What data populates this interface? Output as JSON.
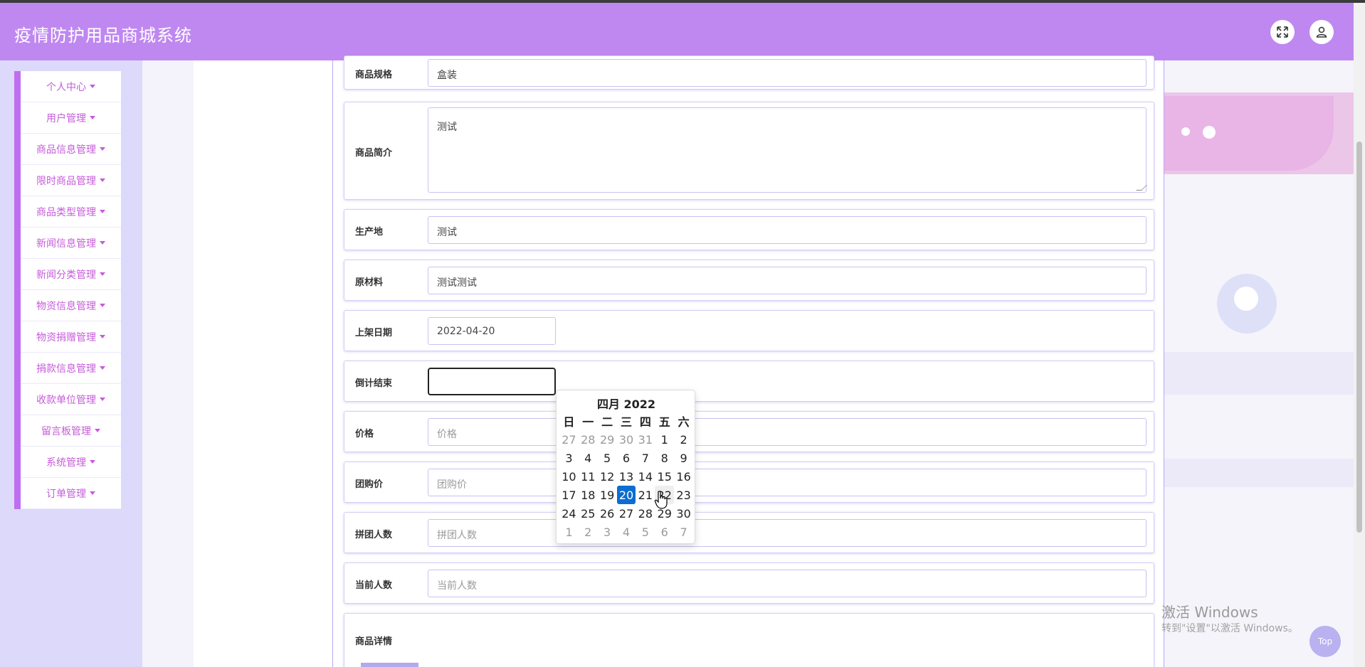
{
  "header": {
    "app_title": "疫情防护用品商城系统",
    "fullscreen_icon": "expand-icon",
    "user_icon": "user-icon"
  },
  "sidebar": {
    "items": [
      {
        "label": "个人中心"
      },
      {
        "label": "用户管理"
      },
      {
        "label": "商品信息管理"
      },
      {
        "label": "限时商品管理"
      },
      {
        "label": "商品类型管理"
      },
      {
        "label": "新闻信息管理"
      },
      {
        "label": "新闻分类管理"
      },
      {
        "label": "物资信息管理"
      },
      {
        "label": "物资捐赠管理"
      },
      {
        "label": "捐款信息管理"
      },
      {
        "label": "收款单位管理"
      },
      {
        "label": "留言板管理"
      },
      {
        "label": "系统管理"
      },
      {
        "label": "订单管理"
      }
    ]
  },
  "form": {
    "spec": {
      "label": "商品规格",
      "value": "盒装"
    },
    "intro": {
      "label": "商品简介",
      "value": "测试"
    },
    "origin": {
      "label": "生产地",
      "value": "测试"
    },
    "material": {
      "label": "原材料",
      "value": "测试测试"
    },
    "listing_date": {
      "label": "上架日期",
      "value": "2022-04-20"
    },
    "countdown_end": {
      "label": "倒计结束",
      "value": ""
    },
    "price": {
      "label": "价格",
      "placeholder": "价格"
    },
    "group_price": {
      "label": "团购价",
      "placeholder": "团购价"
    },
    "group_size": {
      "label": "拼团人数",
      "placeholder": "拼团人数"
    },
    "current_count": {
      "label": "当前人数",
      "placeholder": "当前人数"
    },
    "details": {
      "label": "商品详情"
    }
  },
  "datepicker": {
    "title": "四月 2022",
    "weekdays": [
      "日",
      "一",
      "二",
      "三",
      "四",
      "五",
      "六"
    ],
    "weeks": [
      [
        "27",
        "28",
        "29",
        "30",
        "31",
        "1",
        "2"
      ],
      [
        "3",
        "4",
        "5",
        "6",
        "7",
        "8",
        "9"
      ],
      [
        "10",
        "11",
        "12",
        "13",
        "14",
        "15",
        "16"
      ],
      [
        "17",
        "18",
        "19",
        "20",
        "21",
        "22",
        "23"
      ],
      [
        "24",
        "25",
        "26",
        "27",
        "28",
        "29",
        "30"
      ],
      [
        "1",
        "2",
        "3",
        "4",
        "5",
        "6",
        "7"
      ]
    ],
    "selected_day": "20",
    "hover_day": "22"
  },
  "watermark": {
    "line1": "激活 Windows",
    "line2": "转到\"设置\"以激活 Windows。"
  },
  "back_to_top": "Top"
}
